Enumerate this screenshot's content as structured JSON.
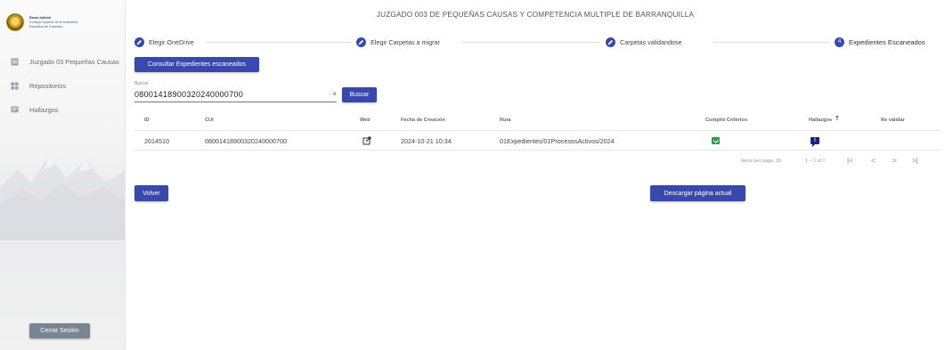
{
  "sidebar": {
    "logo": {
      "line1": "Rama Judicial",
      "line2": "Consejo Superior de la Judicatura",
      "line3": "República de Colombia"
    },
    "items": [
      {
        "label": "Juzgado 03 Pequeñas Causas",
        "icon": "folder-icon"
      },
      {
        "label": "Repositorios",
        "icon": "grid-icon"
      },
      {
        "label": "Hallazgos",
        "icon": "message-icon"
      }
    ],
    "logout_label": "Cerrar Sesión"
  },
  "header": {
    "title": "JUZGADO 003 DE PEQUEÑAS CAUSAS Y COMPETENCIA MULTIPLE DE BARRANQUILLA"
  },
  "stepper": {
    "steps": [
      {
        "label": "Elegir OneDrive",
        "state": "done"
      },
      {
        "label": "Elegir Carpetas a migrar",
        "state": "done"
      },
      {
        "label": "Carpetas validandose",
        "state": "done"
      },
      {
        "label": "Expedientes Escaneados",
        "state": "active",
        "number": "4"
      }
    ]
  },
  "actions": {
    "consult_label": "Consultar Expedientes escaneados",
    "search_button": "Buscar",
    "back_label": "Volver",
    "download_label": "Descargar página actual"
  },
  "search": {
    "label": "Buscar",
    "value": "08001418900320240000700",
    "clear": "×"
  },
  "table": {
    "headers": {
      "id": "ID",
      "cui": "CUI",
      "web": "Web",
      "fecha": "Fecha de Creación",
      "ruta": "Ruta",
      "cumplio": "Cumplió Criterios",
      "hallazgos": "Hallazgos",
      "revalidar": "Re validar"
    },
    "sort_indicator": "🡑",
    "rows": [
      {
        "id": "2014510",
        "cui": "08001418900320240000700",
        "fecha": "2024-10-21 10:34",
        "ruta": "01Expedientes/01ProcesosActivos/2024",
        "hallazgo_mark": "!"
      }
    ]
  },
  "pagination": {
    "items_per_page": "Items per page: 30",
    "range": "1 – 1 of 1",
    "first": "|<",
    "prev": "<",
    "next": ">",
    "last": ">|"
  },
  "colors": {
    "primary": "#3949ab",
    "success": "#2e9b4a",
    "flag": "#1a237e",
    "logout": "#7a8593"
  }
}
